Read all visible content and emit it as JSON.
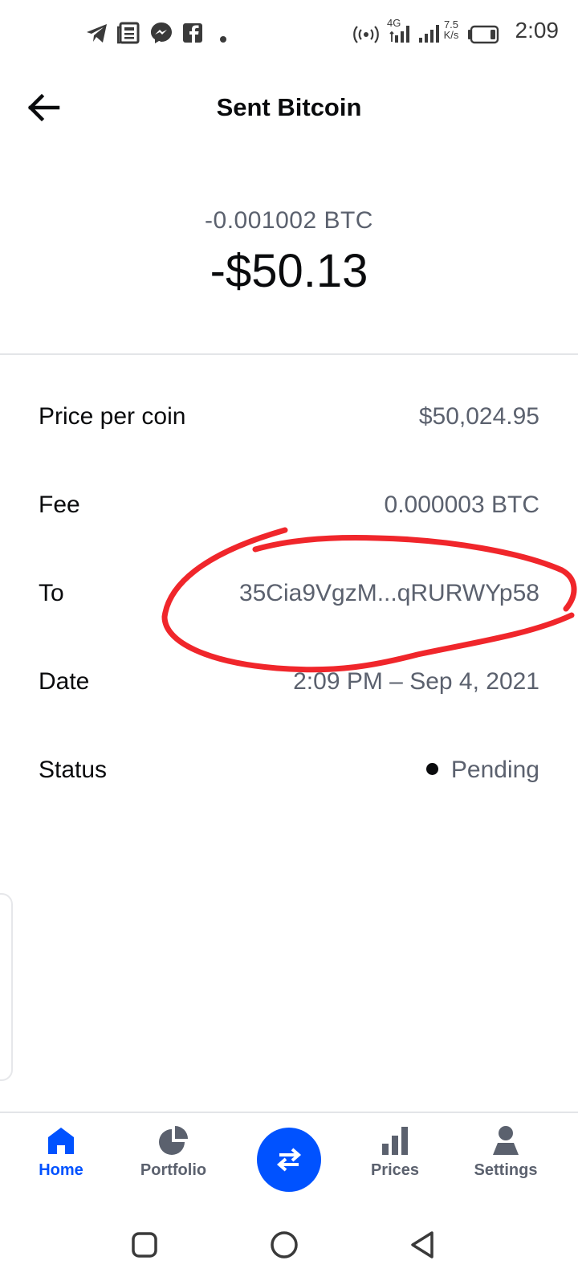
{
  "status_bar": {
    "time": "2:09",
    "net_speed_value": "7.5",
    "net_speed_unit": "K/s",
    "network_type": "4G",
    "icons": [
      "telegram-icon",
      "news-icon",
      "messenger-icon",
      "facebook-icon",
      "dot-icon",
      "hotspot-icon",
      "signal-icon",
      "signal-icon-2",
      "battery-icon"
    ]
  },
  "header": {
    "title": "Sent Bitcoin",
    "back_icon": "arrow-left-icon"
  },
  "amount": {
    "crypto": "-0.001002 BTC",
    "fiat": "-$50.13"
  },
  "details": [
    {
      "label": "Price per coin",
      "value": "$50,024.95"
    },
    {
      "label": "Fee",
      "value": "0.000003 BTC"
    },
    {
      "label": "To",
      "value": "35Cia9VgzM...qRURWYp58"
    },
    {
      "label": "Date",
      "value": "2:09 PM – Sep 4, 2021"
    },
    {
      "label": "Status",
      "value": "Pending"
    }
  ],
  "annotation": {
    "color": "#f0262b",
    "shape": "hand-drawn-circle-around-to-address"
  },
  "bottom_nav": {
    "items": [
      {
        "label": "Home",
        "icon": "home-icon",
        "active": true
      },
      {
        "label": "Portfolio",
        "icon": "pie-chart-icon",
        "active": false
      },
      {
        "label": "",
        "icon": "swap-arrows-icon",
        "active": false
      },
      {
        "label": "Prices",
        "icon": "bar-chart-icon",
        "active": false
      },
      {
        "label": "Settings",
        "icon": "user-icon",
        "active": false
      }
    ]
  },
  "system_nav": {
    "icons": [
      "recents-square-icon",
      "home-circle-icon",
      "back-triangle-icon"
    ]
  },
  "colors": {
    "accent": "#0052ff",
    "primary_text": "#0a0b0d",
    "secondary_text": "#5b616e",
    "divider": "#e3e5e8"
  }
}
